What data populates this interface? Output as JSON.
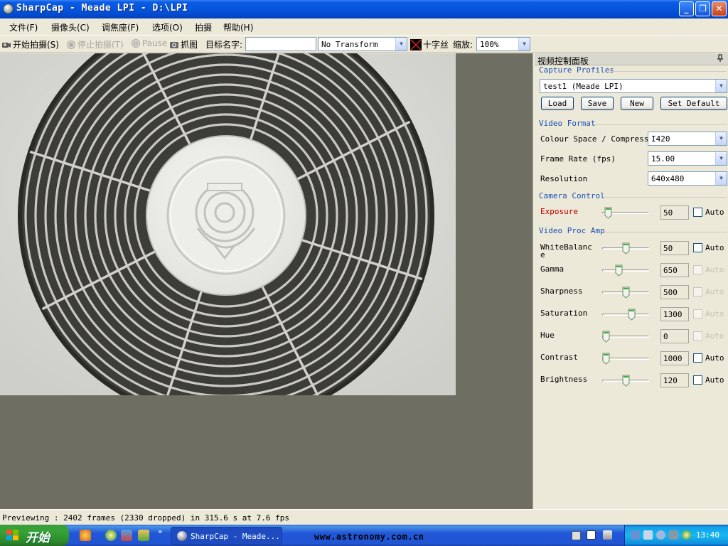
{
  "window": {
    "title": "SharpCap - Meade LPI - D:\\LPI",
    "minimize": "_",
    "maximize": "❐",
    "close": "✕"
  },
  "menu": {
    "items": [
      "文件(F)",
      "摄像头(C)",
      "调焦座(F)",
      "选项(O)",
      "拍摄",
      "帮助(H)"
    ]
  },
  "toolbar": {
    "start_capture": "开始拍摄(S)",
    "stop_capture": "停止拍摄(T)",
    "pause": "Pause",
    "snapshot": "抓图",
    "target_name_label": "目标名字:",
    "target_name_value": "",
    "transform_value": "No Transform",
    "crosshair": "十字丝",
    "zoom_label": "缩放:",
    "zoom_value": "100%"
  },
  "panel": {
    "title": "视频控制面板",
    "pin": "📌",
    "capture_profiles": {
      "heading": "Capture Profiles",
      "profile_value": "test1 (Meade LPI)",
      "buttons": [
        "Load",
        "Save",
        "New",
        "Set Default"
      ]
    },
    "video_format": {
      "heading": "Video Format",
      "rows": [
        {
          "label": "Colour Space / Compressio",
          "value": "I420"
        },
        {
          "label": "Frame Rate (fps)",
          "value": "15.00"
        },
        {
          "label": "Resolution",
          "value": "640x480"
        }
      ]
    },
    "camera_control": {
      "heading": "Camera Control",
      "rows": [
        {
          "label": "Exposure",
          "value": "50",
          "auto": "Auto",
          "auto_enabled": true,
          "level": 0.06,
          "label_color": "#C00000"
        }
      ]
    },
    "proc_amp": {
      "heading": "Video Proc Amp",
      "rows": [
        {
          "label": "WhiteBalanc\ne",
          "value": "50",
          "auto": "Auto",
          "auto_enabled": true,
          "level": 0.5
        },
        {
          "label": "Gamma",
          "value": "650",
          "auto": "Auto",
          "auto_enabled": false,
          "level": 0.32
        },
        {
          "label": "Sharpness",
          "value": "500",
          "auto": "Auto",
          "auto_enabled": false,
          "level": 0.5
        },
        {
          "label": "Saturation",
          "value": "1300",
          "auto": "Auto",
          "auto_enabled": false,
          "level": 0.65
        },
        {
          "label": "Hue",
          "value": "0",
          "auto": "Auto",
          "auto_enabled": false,
          "level": 0.0
        },
        {
          "label": "Contrast",
          "value": "1000",
          "auto": "Auto",
          "auto_enabled": true,
          "level": 0.0
        },
        {
          "label": "Brightness",
          "value": "120",
          "auto": "Auto",
          "auto_enabled": true,
          "level": 0.5
        }
      ]
    }
  },
  "status": {
    "text": "Previewing : 2402 frames (2330 dropped) in 315.6 s at 7.6 fps"
  },
  "taskbar": {
    "start": "开始",
    "more": "»",
    "task_item": "SharpCap - Meade...",
    "website": "www.astronomy.com.cn",
    "clock": "13:40"
  }
}
